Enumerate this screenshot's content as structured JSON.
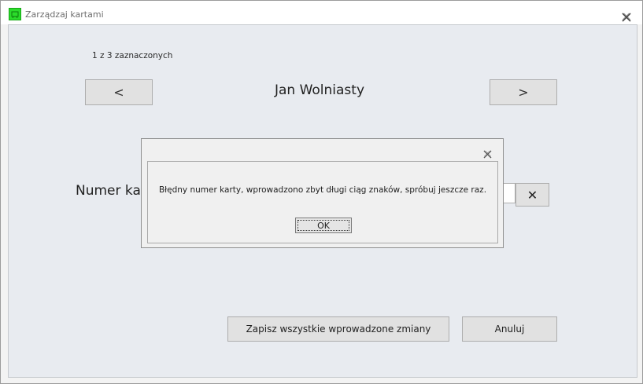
{
  "window": {
    "title": "Zarządzaj kartami",
    "close_icon": "close-icon"
  },
  "main": {
    "selection_counter": "1 z 3 zaznaczonych",
    "prev_label": "<",
    "next_label": ">",
    "person_name": "Jan Wolniasty",
    "card_number_label": "Numer ka",
    "card_number_value": "",
    "clear_label": "✕",
    "save_all_label": "Zapisz wszystkie wprowadzone zmiany",
    "cancel_label": "Anuluj"
  },
  "dialog": {
    "message": "Błędny numer karty, wprowadzono zbyt długi ciąg znaków, spróbuj jeszcze raz.",
    "ok_label": "OK"
  },
  "colors": {
    "app_icon": "#2bdc2b",
    "panel_bg": "#e8ebf0",
    "button_bg": "#e1e1e1"
  }
}
